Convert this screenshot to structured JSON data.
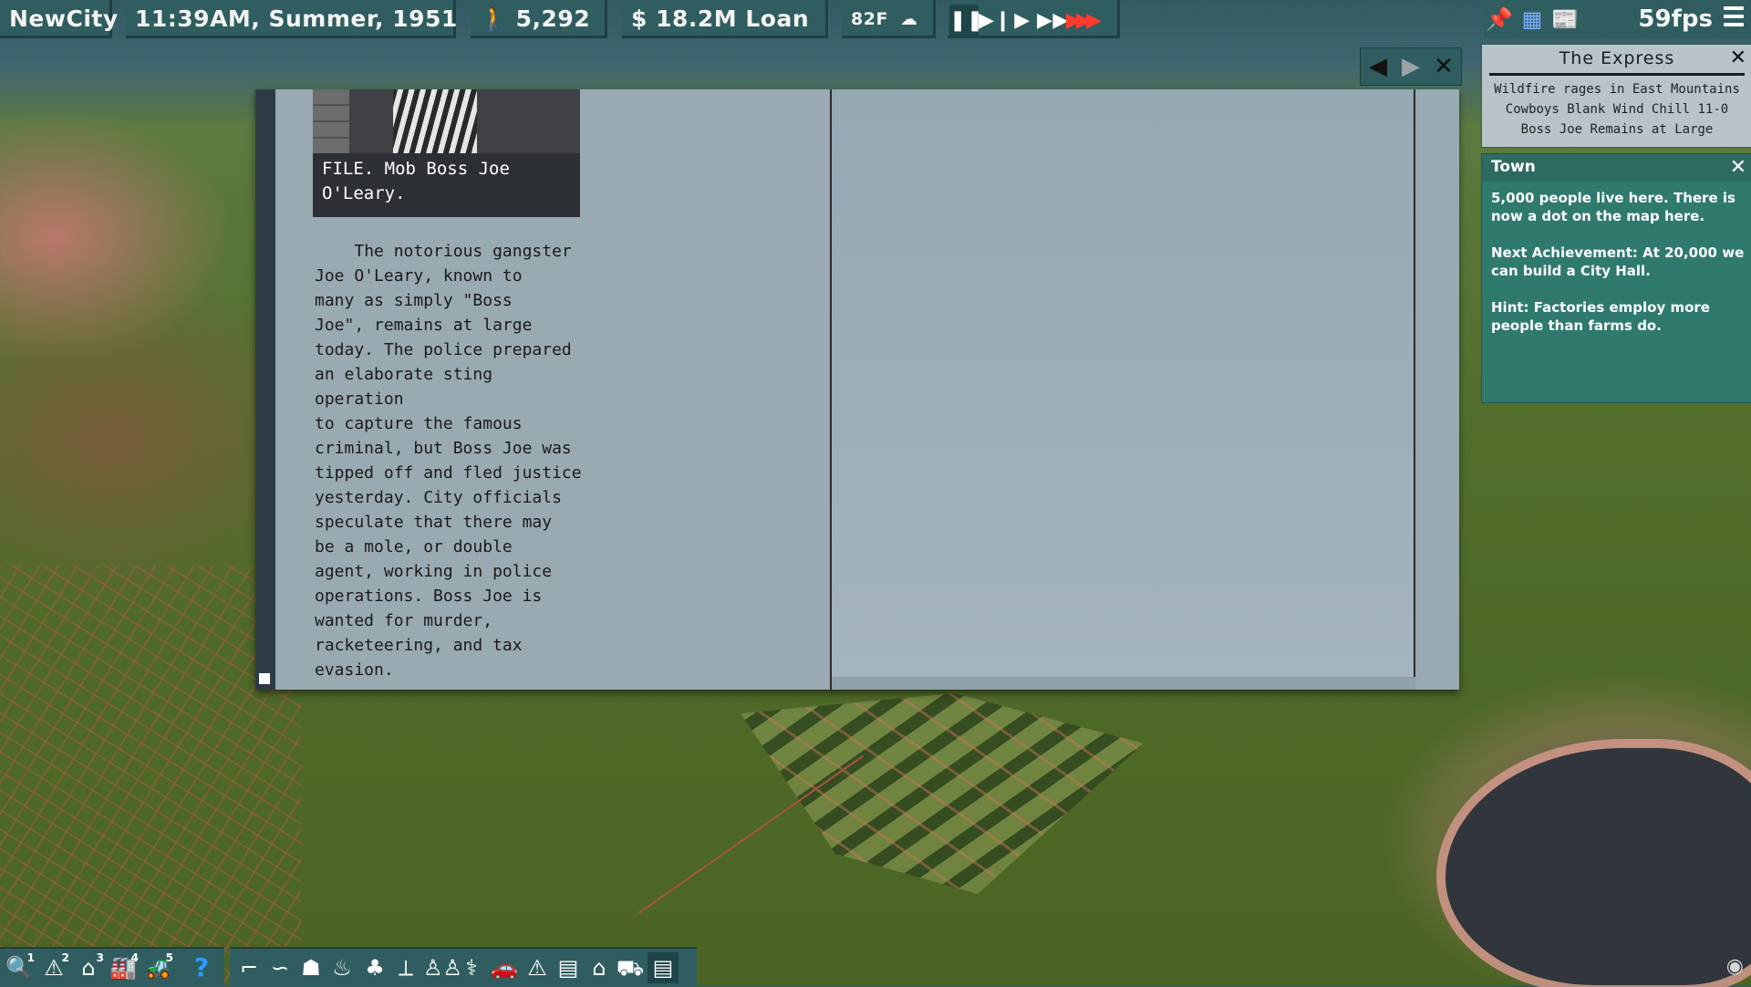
{
  "topbar": {
    "city": "NewCity",
    "datetime": "11:39AM, Summer, 1951",
    "population": "5,292",
    "money": "$ 18.2M Loan",
    "temperature": "82F",
    "fps": "59fps"
  },
  "speed_controls": [
    "pause",
    "step",
    "play",
    "fast",
    "fastest"
  ],
  "newspaper": {
    "photo_caption": "FILE. Mob Boss Joe O'Leary.",
    "article": "    The notorious gangster\nJoe O'Leary, known to\nmany as simply \"Boss\nJoe\", remains at large\ntoday. The police prepared\nan elaborate sting operation\nto capture the famous\ncriminal, but Boss Joe was\ntipped off and fled justice\nyesterday. City officials\nspeculate that there may\nbe a mole, or double\nagent, working in police\noperations. Boss Joe is\nwanted for murder,\nracketeering, and tax\nevasion."
  },
  "express": {
    "title": "The Express",
    "headlines": [
      "Wildfire rages in East Mountains",
      "Cowboys Blank Wind Chill 11-0",
      "Boss Joe Remains at Large"
    ]
  },
  "town_panel": {
    "title": "Town",
    "text1": "5,000 people live here. There is now a dot on the map here.",
    "text2": "Next Achievement: At 20,000 we can build a City Hall.",
    "text3": "Hint: Factories employ more people than farms do."
  },
  "toolbar": {
    "badges": [
      "1",
      "2",
      "3",
      "4",
      "5"
    ]
  },
  "colors": {
    "panel": "#2f5d60",
    "town_panel": "#2f7a6d",
    "newspaper": "#9aaab3",
    "fast_forward": "#ff3b30"
  }
}
